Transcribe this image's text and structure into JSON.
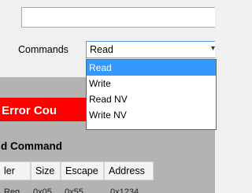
{
  "top_field": {
    "value": ""
  },
  "commands": {
    "label": "Commands",
    "selected": "Read",
    "options": [
      "Read",
      "Write",
      "Read NV",
      "Write NV"
    ],
    "highlighted_index": 0
  },
  "error_banner": {
    "text": "Error Cou"
  },
  "section": {
    "heading": "d Command"
  },
  "table": {
    "columns": [
      "ler",
      "Size",
      "Escape",
      "Address"
    ],
    "partial_row": [
      "Reg",
      "0x05",
      "0x55",
      "0x1234"
    ]
  },
  "colors": {
    "accent": "#3399ff",
    "error": "#ff0000",
    "panel": "#b3b3b3"
  }
}
